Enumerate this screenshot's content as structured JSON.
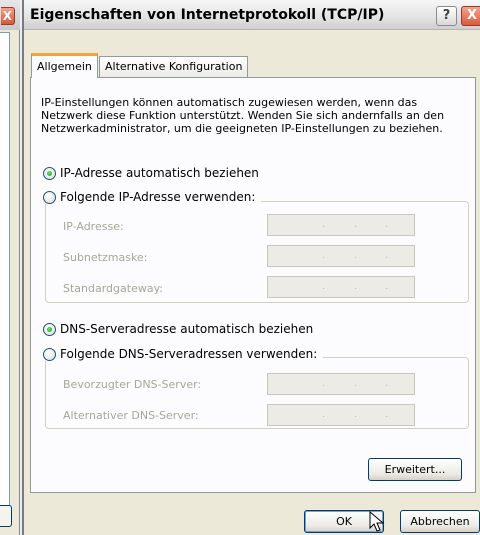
{
  "dialog": {
    "title": "Eigenschaften von Internetprotokoll (TCP/IP)",
    "help_label": "?",
    "close_label": "X"
  },
  "background_window": {
    "close_label": "X"
  },
  "tabs": [
    {
      "label": "Allgemein",
      "active": true
    },
    {
      "label": "Alternative Konfiguration",
      "active": false
    }
  ],
  "general": {
    "info": "IP-Einstellungen können automatisch zugewiesen werden, wenn das Netzwerk diese Funktion unterstützt. Wenden Sie sich andernfalls an den Netzwerkadministrator, um die geeigneten IP-Einstellungen zu beziehen.",
    "ip_auto_label": "IP-Adresse automatisch beziehen",
    "ip_manual_label": "Folgende IP-Adresse verwenden:",
    "ip_fields": [
      {
        "label": "IP-Adresse:",
        "value": ". . ."
      },
      {
        "label": "Subnetzmaske:",
        "value": ". . ."
      },
      {
        "label": "Standardgateway:",
        "value": ". . ."
      }
    ],
    "dns_auto_label": "DNS-Serveradresse automatisch beziehen",
    "dns_manual_label": "Folgende DNS-Serveradressen verwenden:",
    "dns_fields": [
      {
        "label": "Bevorzugter DNS-Server:",
        "value": ". . ."
      },
      {
        "label": "Alternativer DNS-Server:",
        "value": ". . ."
      }
    ],
    "advanced_label": "Erweitert..."
  },
  "footer": {
    "ok_label": "OK",
    "cancel_label": "Abbrechen"
  },
  "colors": {
    "active_tab_accent": "#f3a53a",
    "radio_dot": "#1a9c1a",
    "close_button": "#d95a3c"
  }
}
